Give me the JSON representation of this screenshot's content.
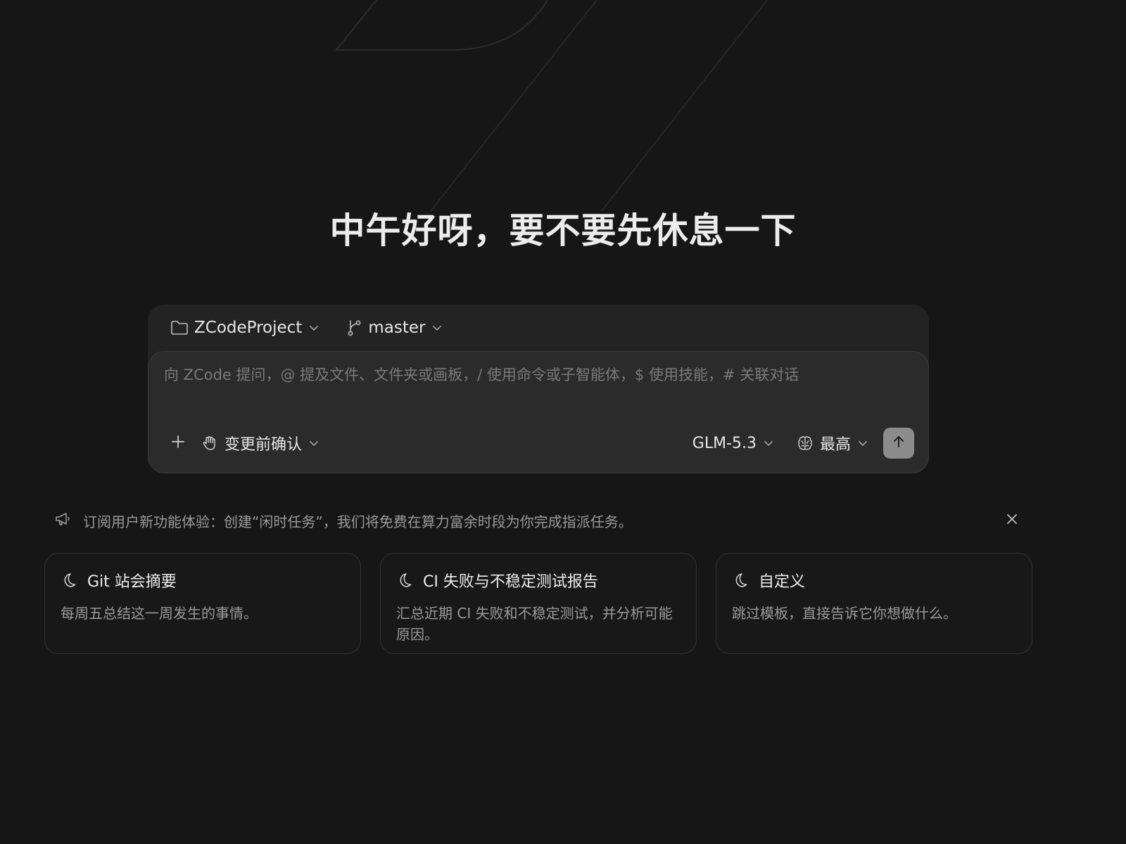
{
  "greeting": "中午好呀，要不要先休息一下",
  "composer": {
    "project": {
      "label": "ZCodeProject",
      "icon": "folder-icon"
    },
    "branch": {
      "label": "master",
      "icon": "git-branch-icon"
    },
    "placeholder": "向 ZCode 提问，@ 提及文件、文件夹或画板，/ 使用命令或子智能体，$ 使用技能，# 关联对话",
    "value": "",
    "mode": {
      "label": "变更前确认",
      "icon": "hand-icon"
    },
    "model": {
      "label": "GLM-5.3"
    },
    "effort": {
      "label": "最高",
      "icon": "brain-icon"
    }
  },
  "notice": {
    "text": "订阅用户新功能体验：创建“闲时任务”，我们将免费在算力富余时段为你完成指派任务。",
    "icon": "megaphone-icon"
  },
  "cards": [
    {
      "title": "Git 站会摘要",
      "description": "每周五总结这一周发生的事情。",
      "icon": "moon-icon"
    },
    {
      "title": "CI 失败与不稳定测试报告",
      "description": "汇总近期 CI 失败和不稳定测试，并分析可能原因。",
      "icon": "moon-icon"
    },
    {
      "title": "自定义",
      "description": "跳过模板，直接告诉它你想做什么。",
      "icon": "moon-icon"
    }
  ],
  "colors": {
    "background": "#161616",
    "composer_outer": "#232323",
    "composer_inner": "#2b2b2b",
    "send_button": "#8c8c8c",
    "muted_text": "#9a9a9a"
  }
}
